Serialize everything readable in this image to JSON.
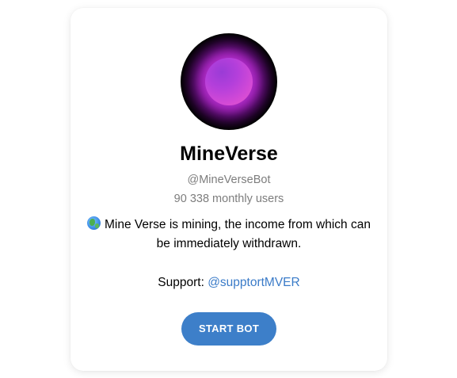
{
  "bot": {
    "name": "MineVerse",
    "username": "@MineVerseBot",
    "monthly_users": "90 338 monthly users",
    "description_line": "Mine Verse is mining, the income from which can be immediately withdrawn.",
    "support_label": "Support: ",
    "support_link": "@supptortMVER",
    "start_button": "START BOT"
  },
  "icons": {
    "avatar": "glowing-purple-orb-avatar",
    "description_emoji": "globe-icon"
  },
  "colors": {
    "accent": "#3d7fc9",
    "link": "#3a7bc8",
    "muted_text": "#7d7d7d"
  }
}
